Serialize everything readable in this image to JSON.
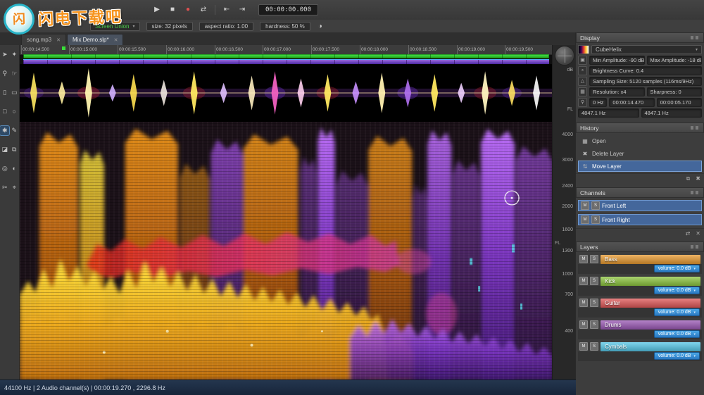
{
  "ui": {
    "close": "✕",
    "arrow": "▾",
    "contrast": "◑"
  },
  "watermark": {
    "badge": "闪",
    "text": "闪电下载吧"
  },
  "toolbar": {
    "transport": {
      "play": "▶",
      "stop": "■",
      "record": "●",
      "loop": "⇄",
      "prev": "⇤",
      "next": "⇥"
    },
    "time_display": "00:00:00.000",
    "mode_select": "Screen Union",
    "size_field": "size: 32 pixels",
    "aspect_field": "aspect ratio: 1.00",
    "hardness_field": "hardness: 50 %"
  },
  "tabs": [
    {
      "label": "song.mp3"
    },
    {
      "label": "Mix Demo.slp*"
    }
  ],
  "timeline_ticks": [
    "00:00:14.500",
    "00:00:15.000",
    "00:00:15.500",
    "00:00:16.000",
    "00:00:16.500",
    "00:00:17.000",
    "00:00:17.500",
    "00:00:18.000",
    "00:00:18.500",
    "00:00:19.000",
    "00:00:19.500"
  ],
  "scales": {
    "db": "dB",
    "wave_channel": "FL",
    "spec_channel": "FL",
    "freq_labels": [
      "4000",
      "3000",
      "2400",
      "2000",
      "1600",
      "1300",
      "1000",
      "700",
      "400"
    ]
  },
  "tools": [
    {
      "name": "arrow",
      "glyph": "➤"
    },
    {
      "name": "magic-wand",
      "glyph": "✦"
    },
    {
      "name": "zoom",
      "glyph": "⚲"
    },
    {
      "name": "hand",
      "glyph": "☞"
    },
    {
      "name": "time-selection",
      "glyph": "▯"
    },
    {
      "name": "frequency-selection",
      "glyph": "▭"
    },
    {
      "name": "rectangular-selection",
      "glyph": "□"
    },
    {
      "name": "lasso-selection",
      "glyph": "○"
    },
    {
      "name": "brush",
      "glyph": "✱",
      "selected": true
    },
    {
      "name": "pencil",
      "glyph": "✎"
    },
    {
      "name": "eraser",
      "glyph": "◪"
    },
    {
      "name": "clone-stamp",
      "glyph": "⧉"
    },
    {
      "name": "amplify",
      "glyph": "◎"
    },
    {
      "name": "blur",
      "glyph": "◐"
    },
    {
      "name": "scissors",
      "glyph": "✂"
    },
    {
      "name": "measure",
      "glyph": "⌖"
    }
  ],
  "panels": {
    "display": {
      "title": "Display",
      "colormap": "CubeHelix",
      "icons": {
        "amp": "▣",
        "brightness": "◓",
        "sampling": "△",
        "resolution": "▦",
        "cursor": "⚲"
      },
      "min_amplitude": "Min Amplitude: -90 dB",
      "max_amplitude": "Max Amplitude: -18 dB",
      "brightness_curve": "Brightness Curve: 0.4",
      "sampling_size": "Sampling Size: 5120 samples (116ms/9Hz)",
      "resolution": "Resolution: x4",
      "sharpness": "Sharpness: 0",
      "cursor_freq": "0 Hz",
      "sel_start": "00:00:14.470",
      "sel_length": "00:00:05.170",
      "freq_a": "4847.1 Hz",
      "freq_b": "4847.1 Hz"
    },
    "history": {
      "title": "History",
      "items": [
        {
          "icon": "▦",
          "label": "Open"
        },
        {
          "icon": "✖",
          "label": "Delete Layer"
        },
        {
          "icon": "⇅",
          "label": "Move Layer"
        }
      ],
      "footer": [
        "⧉",
        "✖"
      ]
    },
    "channels": {
      "title": "Channels",
      "mute": "M",
      "solo": "S",
      "items": [
        {
          "label": "Front Left"
        },
        {
          "label": "Front Right"
        }
      ],
      "footer": [
        "⇄",
        "✕"
      ]
    },
    "layers": {
      "title": "Layers",
      "mute": "M",
      "solo": "S",
      "items": [
        {
          "label": "Bass",
          "color": "#e89a30",
          "volume": "volume: 0.0 dB"
        },
        {
          "label": "Kick",
          "color": "#8dc63f",
          "volume": "volume: 0.0 dB"
        },
        {
          "label": "Guitar",
          "color": "#e05858",
          "volume": "volume: 0.0 dB"
        },
        {
          "label": "Drums",
          "color": "#9b59b6",
          "volume": "volume: 0.0 dB"
        },
        {
          "label": "Cymbals",
          "color": "#56c8e8",
          "volume": "volume: 0.0 dB"
        }
      ]
    }
  },
  "status_bar": "44100 Hz | 2 Audio channel(s) | 00:00:19.270 , 2296.8 Hz"
}
